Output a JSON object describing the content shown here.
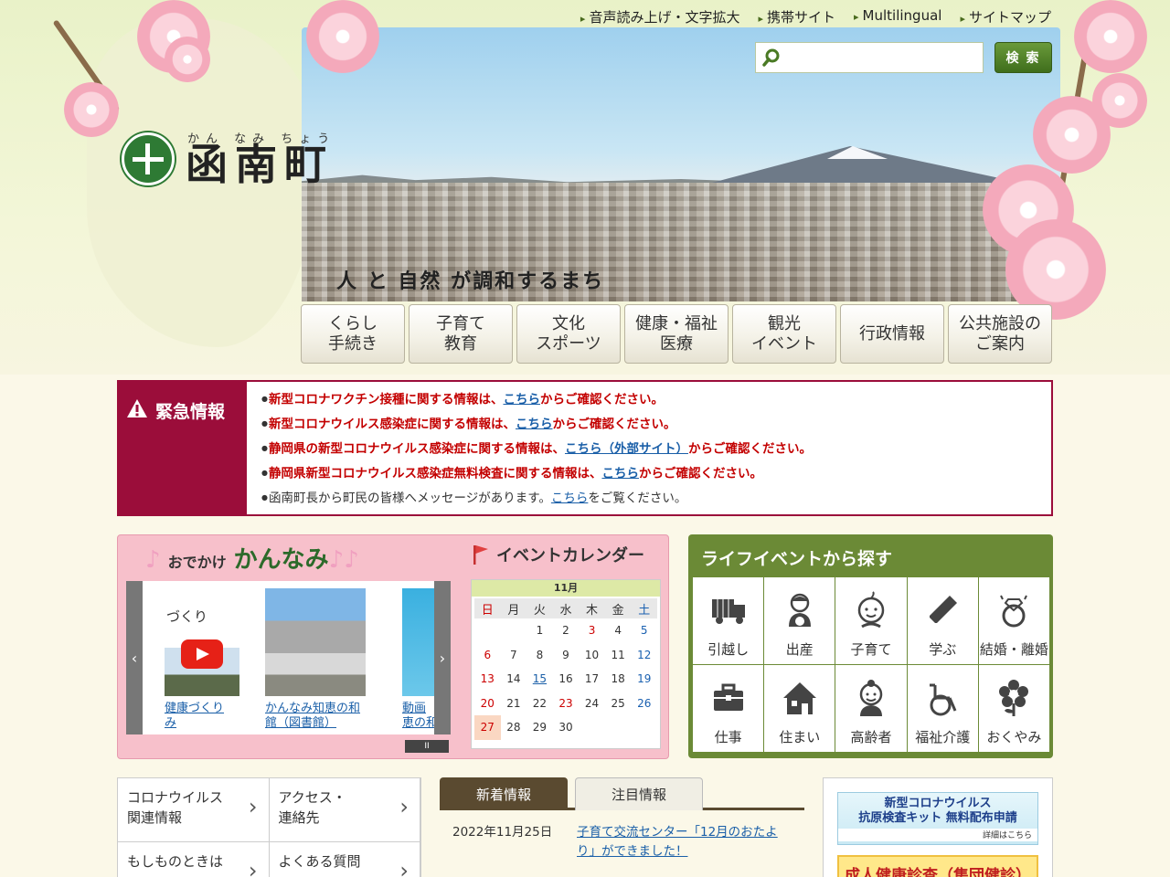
{
  "header": {
    "util_nav": [
      "音声読み上げ・文字拡大",
      "携帯サイト",
      "Multilingual",
      "サイトマップ"
    ],
    "search": {
      "placeholder": "",
      "button_label": "検 索"
    },
    "logo": {
      "ruby": "かん なみ ちょう",
      "name": "函南町"
    },
    "tagline": {
      "w1": "人",
      "w2": "と",
      "w3": "自然",
      "rest": "が調和するまち"
    },
    "global_nav": [
      "くらし\n手続き",
      "子育て\n教育",
      "文化\nスポーツ",
      "健康・福祉\n医療",
      "観光\nイベント",
      "行政情報",
      "公共施設の\nご案内"
    ]
  },
  "emergency": {
    "title": "緊急情報",
    "items": [
      {
        "before": "新型コロナワクチン接種に関する情報は、",
        "link": "こちら",
        "after": "からご確認ください。"
      },
      {
        "before": "新型コロナウイルス感染症に関する情報は、",
        "link": "こちら",
        "after": "からご確認ください。"
      },
      {
        "before": "静岡県の新型コロナウイルス感染症に関する情報は、",
        "link": "こちら（外部サイト）",
        "after": "からご確認ください。"
      },
      {
        "before": "静岡県新型コロナウイルス感染症無料検査に関する情報は、",
        "link": "こちら",
        "after": "からご確認ください。"
      },
      {
        "before": "函南町長から町民の皆様へメッセージがあります。",
        "link": "こちら",
        "after": "をご覧ください。"
      }
    ]
  },
  "odekake": {
    "title_sub": "おでかけ",
    "title_main": "かんなみ",
    "slides": [
      {
        "caption1": "健康づくり",
        "caption2": "み",
        "thumb_text": "づくり"
      },
      {
        "caption1": "かんなみ知恵の和",
        "caption2": "館（図書館）"
      },
      {
        "caption1": "動画",
        "caption2": "恵の和"
      }
    ],
    "pause_label": "II"
  },
  "calendar": {
    "title": "イベントカレンダー",
    "month": "11月",
    "dow": [
      "日",
      "月",
      "火",
      "水",
      "木",
      "金",
      "土"
    ],
    "weeks": [
      [
        "",
        "",
        "1",
        "2",
        "3",
        "4",
        "5"
      ],
      [
        "6",
        "7",
        "8",
        "9",
        "10",
        "11",
        "12"
      ],
      [
        "13",
        "14",
        "15",
        "16",
        "17",
        "18",
        "19"
      ],
      [
        "20",
        "21",
        "22",
        "23",
        "24",
        "25",
        "26"
      ],
      [
        "27",
        "28",
        "29",
        "30",
        "",
        "",
        ""
      ]
    ],
    "holidays": [
      "3",
      "23"
    ],
    "event_days": [
      "15"
    ],
    "today": "27"
  },
  "life_events": {
    "title": "ライフイベントから探す",
    "items": [
      {
        "label": "引越し",
        "icon": "truck-icon"
      },
      {
        "label": "出産",
        "icon": "mother-icon"
      },
      {
        "label": "子育て",
        "icon": "baby-icon"
      },
      {
        "label": "学ぶ",
        "icon": "pencil-icon"
      },
      {
        "label": "結婚・離婚",
        "icon": "ring-icon"
      },
      {
        "label": "仕事",
        "icon": "briefcase-icon"
      },
      {
        "label": "住まい",
        "icon": "house-icon"
      },
      {
        "label": "高齢者",
        "icon": "elder-icon"
      },
      {
        "label": "福祉介護",
        "icon": "wheelchair-icon"
      },
      {
        "label": "おくやみ",
        "icon": "flower-icon"
      }
    ]
  },
  "quick_links": [
    "コロナウイルス\n関連情報",
    "アクセス・\n連絡先",
    "もしものときは",
    "よくある質問"
  ],
  "news": {
    "tabs": [
      "新着情報",
      "注目情報"
    ],
    "items": [
      {
        "date": "2022年11月25日",
        "title": "子育て交流センター「12月のおたより」ができました！"
      }
    ]
  },
  "banners": {
    "b1_line1": "新型コロナウイルス",
    "b1_line2": "抗原検査キット 無料配布申請",
    "b1_line3": "詳細はこちら",
    "b2": "成人健康診査（集団健診）"
  }
}
